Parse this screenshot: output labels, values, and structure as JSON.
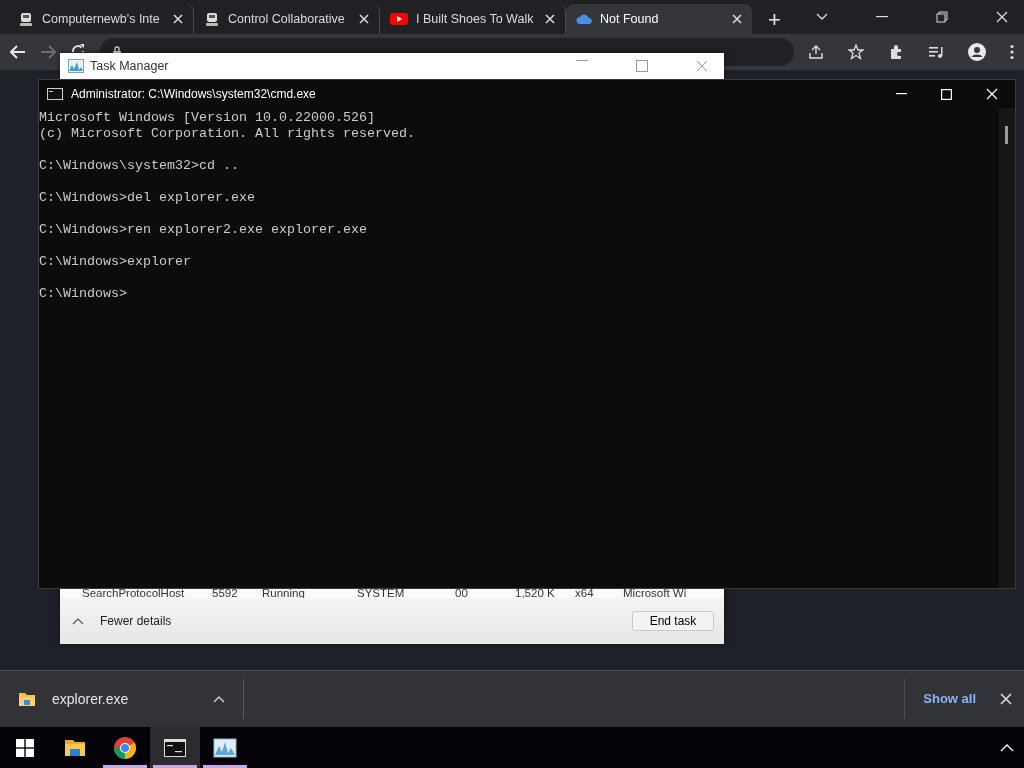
{
  "browser": {
    "tabs": [
      {
        "title": "Computernewb's Inte",
        "kind": "server",
        "selected": false
      },
      {
        "title": "Control Collaborative",
        "kind": "server",
        "selected": false
      },
      {
        "title": "I Built Shoes To Walk",
        "kind": "video",
        "selected": false
      },
      {
        "title": "Not Found",
        "kind": "cloud",
        "selected": true
      }
    ],
    "new_tab": "+",
    "forward_disabled": true
  },
  "task_manager": {
    "title": "Task Manager",
    "row": [
      "SearchProtocolHost",
      "5592",
      "Running",
      "SYSTEM",
      "00",
      "1,520 K",
      "x64",
      "Microsoft Wi"
    ],
    "fewer_details": "Fewer details",
    "end_task": "End task"
  },
  "cmd": {
    "title": "Administrator: C:\\Windows\\system32\\cmd.exe",
    "paragraphs": [
      [
        "Microsoft Windows [Version 10.0.22000.526]",
        "(c) Microsoft Corporation. All rights reserved."
      ],
      [
        "C:\\Windows\\system32>cd .."
      ],
      [
        "C:\\Windows>del explorer.exe"
      ],
      [
        "C:\\Windows>ren explorer2.exe explorer.exe"
      ],
      [
        "C:\\Windows>explorer"
      ],
      [
        "C:\\Windows>"
      ]
    ]
  },
  "download_bar": {
    "file": "explorer.exe",
    "show_all": "Show all"
  },
  "taskbar": {
    "apps": [
      {
        "kind": "folder",
        "running": false,
        "selected": false
      },
      {
        "kind": "chrome",
        "running": true,
        "selected": false
      },
      {
        "kind": "terminal",
        "running": true,
        "selected": true
      },
      {
        "kind": "monitor",
        "running": true,
        "selected": false
      }
    ]
  }
}
